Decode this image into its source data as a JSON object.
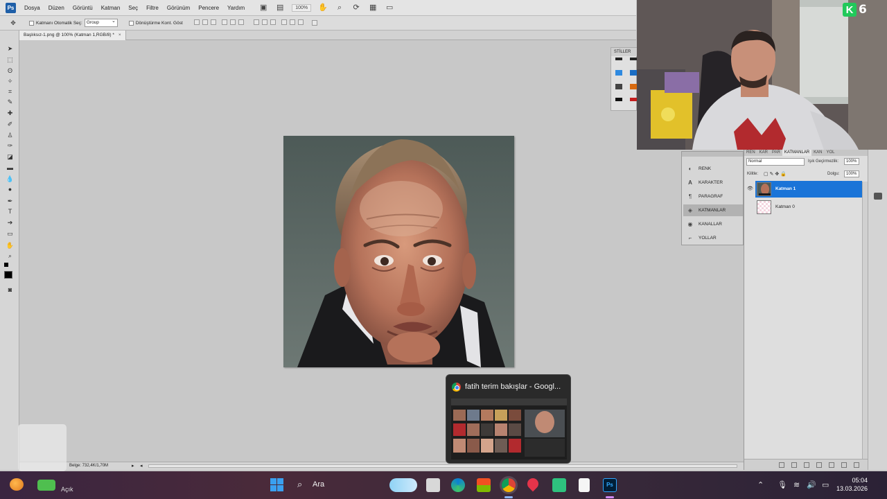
{
  "menubar": {
    "logo": "Ps",
    "items": [
      "Dosya",
      "Düzen",
      "Görüntü",
      "Katman",
      "Seç",
      "Filtre",
      "Görünüm",
      "Pencere",
      "Yardım"
    ],
    "zoom": "100%"
  },
  "options": {
    "auto_select_label": "Katmanı Otomatik Seç:",
    "auto_select_value": "Group",
    "transform_controls_label": "Dönüştürme Kont. Göst"
  },
  "document": {
    "tab_title": "Başlıksız-1.png @ 100% (Katman 1,RGB/8) *",
    "close": "×"
  },
  "status": {
    "doc_info": "Belge: 732,4K/1,70M"
  },
  "styles_panel": {
    "title": "STİLLER"
  },
  "webcam": {
    "badge_letter": "K",
    "badge_number": "6"
  },
  "panel_nav": {
    "items": [
      {
        "label": "RENK",
        "icon": "color-icon"
      },
      {
        "label": "KARAKTER",
        "icon": "character-icon"
      },
      {
        "label": "PARAGRAF",
        "icon": "paragraph-icon"
      },
      {
        "label": "KATMANLAR",
        "icon": "layers-icon"
      },
      {
        "label": "KANALLAR",
        "icon": "channels-icon"
      },
      {
        "label": "YOLLAR",
        "icon": "paths-icon"
      }
    ],
    "active_index": 3
  },
  "layers_panel": {
    "tabs": [
      "REN",
      "KAR",
      "PAR",
      "KATMANLAR",
      "KAN",
      "YOL"
    ],
    "active_tab": "KATMANLAR",
    "blend_mode": "Normal",
    "opacity_label": "Işık Geçirmezlik:",
    "opacity_value": "100%",
    "lock_label": "Kilitle:",
    "fill_label": "Dolgu:",
    "fill_value": "100%",
    "layers": [
      {
        "name": "Katman 1",
        "selected": true
      },
      {
        "name": "Katman 0",
        "selected": false
      }
    ]
  },
  "preview": {
    "title": "fatih terim bakışlar - Googl..."
  },
  "taskbar": {
    "search_label": "Ara",
    "weather_label": "Açık",
    "time": "05:04",
    "date": "13.03.2026"
  },
  "colors": {
    "selection": "#1a74d8",
    "menubar": "#e4e4e4",
    "workspace": "#c8c8c8"
  }
}
